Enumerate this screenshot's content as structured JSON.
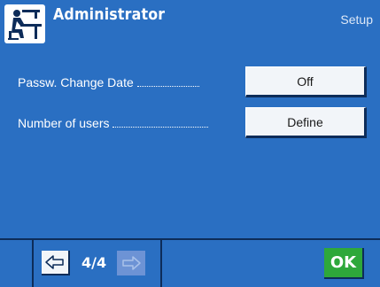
{
  "header": {
    "title": "Administrator",
    "mode": "Setup",
    "icon": "administrator-person-at-desk-icon"
  },
  "settings": [
    {
      "label": "Passw. Change Date",
      "value": "Off"
    },
    {
      "label": "Number of users",
      "value": "Define"
    }
  ],
  "footer": {
    "page": "4/4",
    "prev_icon": "arrow-left-icon",
    "next_icon": "arrow-right-icon",
    "next_enabled": false,
    "ok_label": "OK"
  },
  "colors": {
    "background": "#2a6fc2",
    "button_face": "#f2f5f9",
    "button_shadow": "#0d2c59",
    "ok_green": "#2ea83a",
    "disabled_button": "#6d93d5"
  }
}
